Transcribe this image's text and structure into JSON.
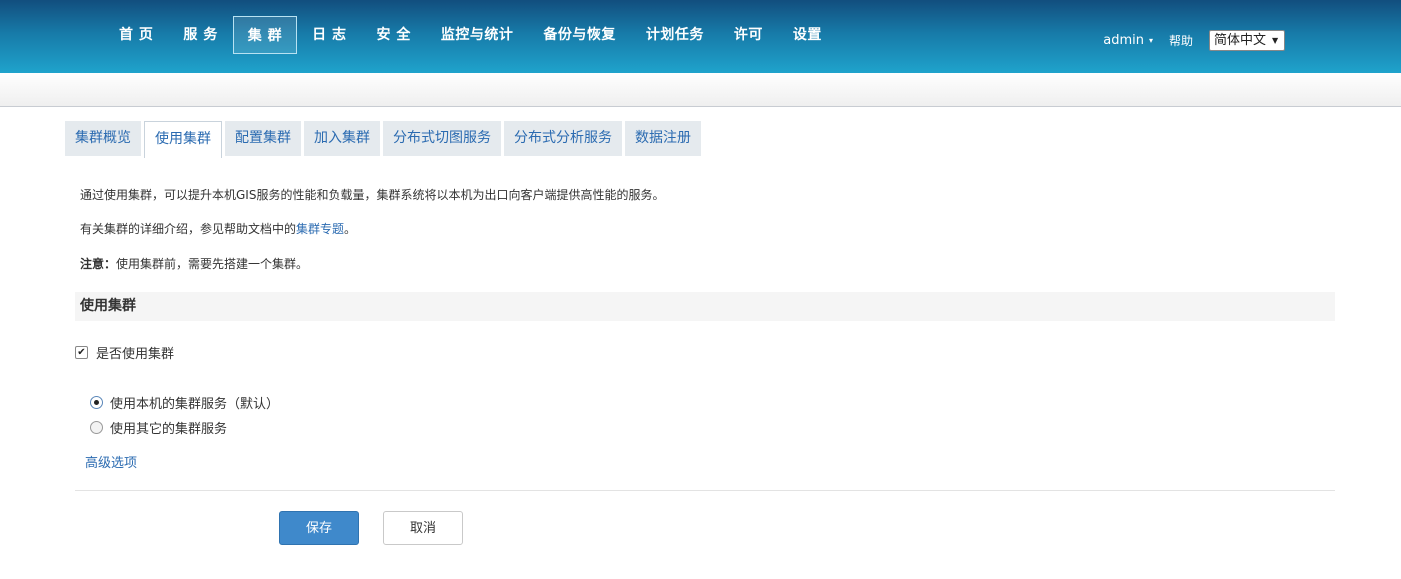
{
  "nav": {
    "items": [
      {
        "label": "首 页",
        "active": false
      },
      {
        "label": "服 务",
        "active": false
      },
      {
        "label": "集 群",
        "active": true
      },
      {
        "label": "日 志",
        "active": false
      },
      {
        "label": "安 全",
        "active": false
      },
      {
        "label": "监控与统计",
        "active": false
      },
      {
        "label": "备份与恢复",
        "active": false
      },
      {
        "label": "计划任务",
        "active": false
      },
      {
        "label": "许可",
        "active": false
      },
      {
        "label": "设置",
        "active": false
      }
    ],
    "user": "admin",
    "help": "帮助",
    "language": "简体中文"
  },
  "tabs": [
    {
      "label": "集群概览",
      "active": false
    },
    {
      "label": "使用集群",
      "active": true
    },
    {
      "label": "配置集群",
      "active": false
    },
    {
      "label": "加入集群",
      "active": false
    },
    {
      "label": "分布式切图服务",
      "active": false
    },
    {
      "label": "分布式分析服务",
      "active": false
    },
    {
      "label": "数据注册",
      "active": false
    }
  ],
  "content": {
    "intro": "通过使用集群，可以提升本机GIS服务的性能和负载量，集群系统将以本机为出口向客户端提供高性能的服务。",
    "help_prefix": "有关集群的详细介绍，参见帮助文档中的",
    "help_link": "集群专题",
    "help_suffix": "。",
    "note_label": "注意：",
    "note_text": "使用集群前，需要先搭建一个集群。"
  },
  "section": {
    "title": "使用集群",
    "checkbox_label": "是否使用集群",
    "checkbox_checked": true,
    "options": [
      {
        "label": "使用本机的集群服务（默认）",
        "checked": true
      },
      {
        "label": "使用其它的集群服务",
        "checked": false
      }
    ],
    "advanced_link": "高级选项"
  },
  "buttons": {
    "save": "保存",
    "cancel": "取消"
  },
  "colors": {
    "header_top": "#124e7e",
    "header_bottom": "#1fa3cc",
    "link": "#2b6bb1",
    "primary_button": "#3f89cb"
  }
}
